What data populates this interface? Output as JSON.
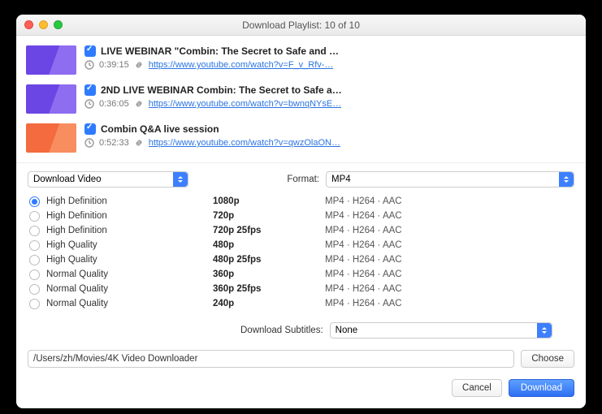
{
  "window": {
    "title": "Download Playlist: 10 of 10"
  },
  "items": [
    {
      "checked": true,
      "thumb": "purple",
      "title": "LIVE WEBINAR \"Combin: The Secret to Safe and …",
      "duration": "0:39:15",
      "url": "https://www.youtube.com/watch?v=F_v_Rfv-…"
    },
    {
      "checked": true,
      "thumb": "purple",
      "title": "2ND LIVE WEBINAR Combin: The Secret to Safe a…",
      "duration": "0:36:05",
      "url": "https://www.youtube.com/watch?v=bwnqNYsE…"
    },
    {
      "checked": true,
      "thumb": "orange",
      "title": "Combin Q&A live session",
      "duration": "0:52:33",
      "url": "https://www.youtube.com/watch?v=qwzOlaON…"
    }
  ],
  "action_select": {
    "value": "Download Video"
  },
  "format": {
    "label": "Format:",
    "value": "MP4"
  },
  "qualities": [
    {
      "selected": true,
      "name": "High Definition",
      "res": "1080p",
      "fmt": "MP4 · H264 · AAC"
    },
    {
      "selected": false,
      "name": "High Definition",
      "res": "720p",
      "fmt": "MP4 · H264 · AAC"
    },
    {
      "selected": false,
      "name": "High Definition",
      "res": "720p 25fps",
      "fmt": "MP4 · H264 · AAC"
    },
    {
      "selected": false,
      "name": "High Quality",
      "res": "480p",
      "fmt": "MP4 · H264 · AAC"
    },
    {
      "selected": false,
      "name": "High Quality",
      "res": "480p 25fps",
      "fmt": "MP4 · H264 · AAC"
    },
    {
      "selected": false,
      "name": "Normal Quality",
      "res": "360p",
      "fmt": "MP4 · H264 · AAC"
    },
    {
      "selected": false,
      "name": "Normal Quality",
      "res": "360p 25fps",
      "fmt": "MP4 · H264 · AAC"
    },
    {
      "selected": false,
      "name": "Normal Quality",
      "res": "240p",
      "fmt": "MP4 · H264 · AAC"
    }
  ],
  "subtitles": {
    "label": "Download Subtitles:",
    "value": "None"
  },
  "path": {
    "value": "/Users/zh/Movies/4K Video Downloader",
    "choose": "Choose"
  },
  "footer": {
    "cancel": "Cancel",
    "download": "Download"
  }
}
